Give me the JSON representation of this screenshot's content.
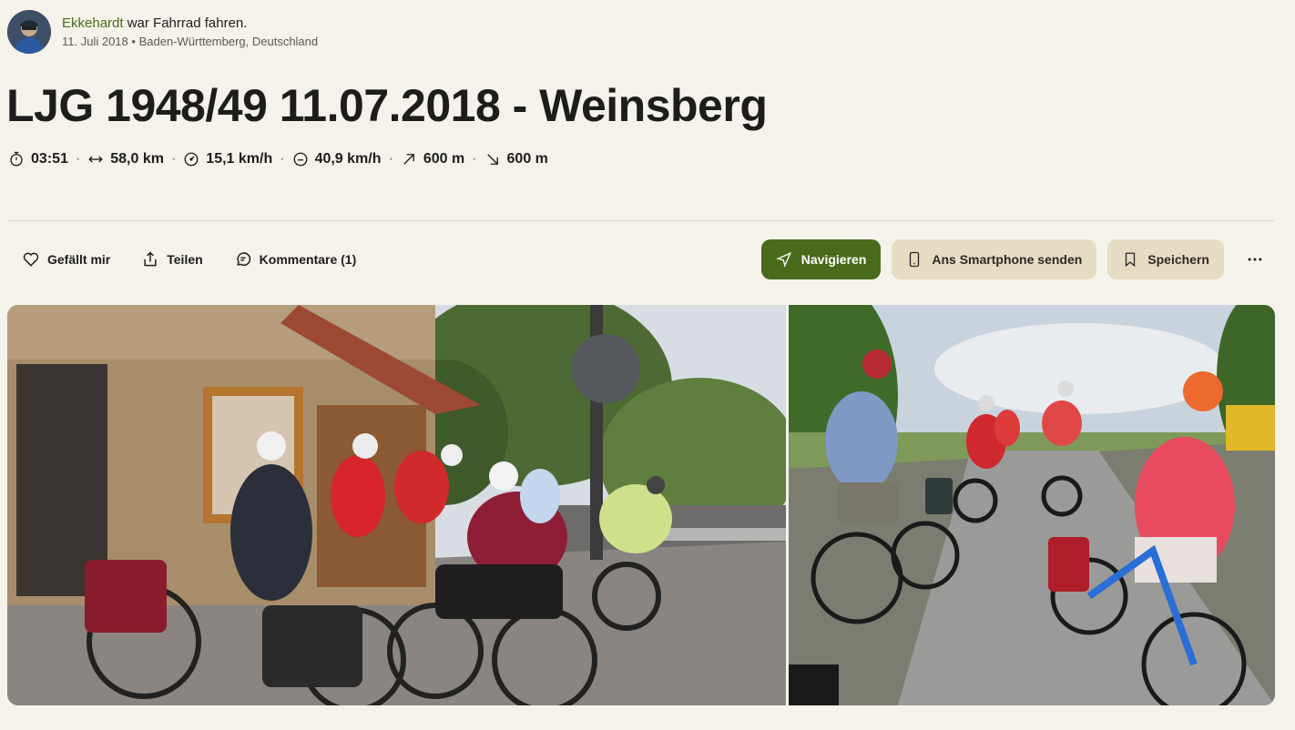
{
  "author": {
    "name": "Ekkehardt",
    "action": "war Fahrrad fahren.",
    "date": "11. Juli 2018",
    "bullet": "•",
    "location": "Baden-Württemberg, Deutschland"
  },
  "title": "LJG 1948/49 11.07.2018 - Weinsberg",
  "stats": {
    "duration": "03:51",
    "distance": "58,0 km",
    "avg_speed": "15,1 km/h",
    "max_speed": "40,9 km/h",
    "uphill": "600 m",
    "downhill": "600 m",
    "separator": "·"
  },
  "actions": {
    "like": "Gefällt mir",
    "share": "Teilen",
    "comments": "Kommentare (1)"
  },
  "buttons": {
    "navigate": "Navigieren",
    "send_to_phone": "Ans Smartphone senden",
    "save": "Speichern"
  },
  "colors": {
    "background": "#f5f2eb",
    "accent": "#4a6b1b",
    "secondary_button": "#e6dcc3"
  }
}
